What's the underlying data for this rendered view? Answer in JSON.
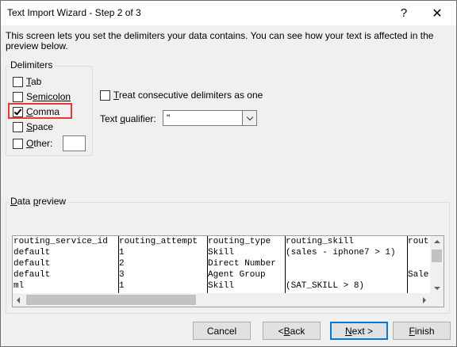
{
  "window": {
    "title": "Text Import Wizard - Step 2 of 3",
    "help_glyph": "?",
    "close_glyph": "✕"
  },
  "description": "This screen lets you set the delimiters your data contains.  You can see how your text is affected in the preview below.",
  "delimiters": {
    "label": "Delimiters",
    "tab": {
      "first": "T",
      "rest": "ab",
      "checked": false
    },
    "semicolon": {
      "first": "S",
      "mid": "",
      "rest": "emicolon",
      "checked": false
    },
    "comma": {
      "first": "C",
      "rest": "omma",
      "checked": true
    },
    "space": {
      "first": "S",
      "rest": "pace",
      "checked": false
    },
    "other": {
      "first": "O",
      "rest": "ther:",
      "checked": false,
      "value": ""
    }
  },
  "consecutive": {
    "first": "T",
    "rest": "reat consecutive delimiters as one",
    "checked": false
  },
  "qualifier": {
    "pre": "Text ",
    "u": "q",
    "post": "ualifier:",
    "value": "\""
  },
  "preview": {
    "label_u": "D",
    "label_mid": "ata ",
    "label_u2": "p",
    "label_rest": "review",
    "rows": [
      [
        "routing_service_id",
        "routing_attempt",
        "routing_type",
        "routing_skill",
        "rout"
      ],
      [
        "default",
        "1",
        "Skill",
        "(sales - iphone7 > 1)",
        ""
      ],
      [
        "default",
        "2",
        "Direct Number",
        "",
        ""
      ],
      [
        "default",
        "3",
        "Agent Group",
        "",
        "Sale"
      ],
      [
        "ml",
        "1",
        "Skill",
        "(SAT_SKILL > 8)",
        ""
      ]
    ]
  },
  "buttons": {
    "cancel": "Cancel",
    "back_pre": "< ",
    "back_u": "B",
    "back_rest": "ack",
    "next_u": "N",
    "next_rest": "ext >",
    "finish_u": "F",
    "finish_rest": "inish"
  },
  "colors": {
    "highlight": "#e53935",
    "focus": "#0078d7"
  }
}
